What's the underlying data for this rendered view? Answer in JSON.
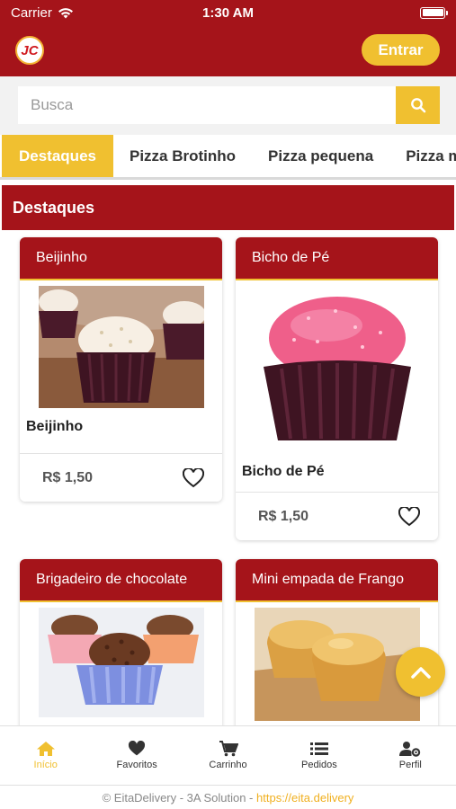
{
  "status_bar": {
    "carrier": "Carrier",
    "time": "1:30 AM"
  },
  "header": {
    "logo_text": "JC",
    "login_label": "Entrar"
  },
  "search": {
    "placeholder": "Busca"
  },
  "tabs": [
    {
      "label": "Destaques",
      "active": true
    },
    {
      "label": "Pizza Brotinho",
      "active": false
    },
    {
      "label": "Pizza pequena",
      "active": false
    },
    {
      "label": "Pizza m",
      "active": false
    }
  ],
  "section": {
    "title": "Destaques"
  },
  "products": [
    {
      "header": "Beijinho",
      "name": "Beijinho",
      "price": "R$ 1,50"
    },
    {
      "header": "Bicho de Pé",
      "name": "Bicho de Pé",
      "price": "R$ 1,50"
    },
    {
      "header": "Brigadeiro de chocolate",
      "name": "",
      "price": ""
    },
    {
      "header": "Mini empada de Frango",
      "name": "",
      "price": ""
    }
  ],
  "tabbar": [
    {
      "label": "Início",
      "icon": "home-icon",
      "active": true
    },
    {
      "label": "Favoritos",
      "icon": "heart-icon",
      "active": false
    },
    {
      "label": "Carrinho",
      "icon": "cart-icon",
      "active": false
    },
    {
      "label": "Pedidos",
      "icon": "list-icon",
      "active": false
    },
    {
      "label": "Perfil",
      "icon": "user-gear-icon",
      "active": false
    }
  ],
  "footer": {
    "text": "© EitaDelivery - 3A Solution - ",
    "link": "https://eita.delivery"
  },
  "colors": {
    "brand_red": "#a5141a",
    "accent_yellow": "#f0c030"
  }
}
